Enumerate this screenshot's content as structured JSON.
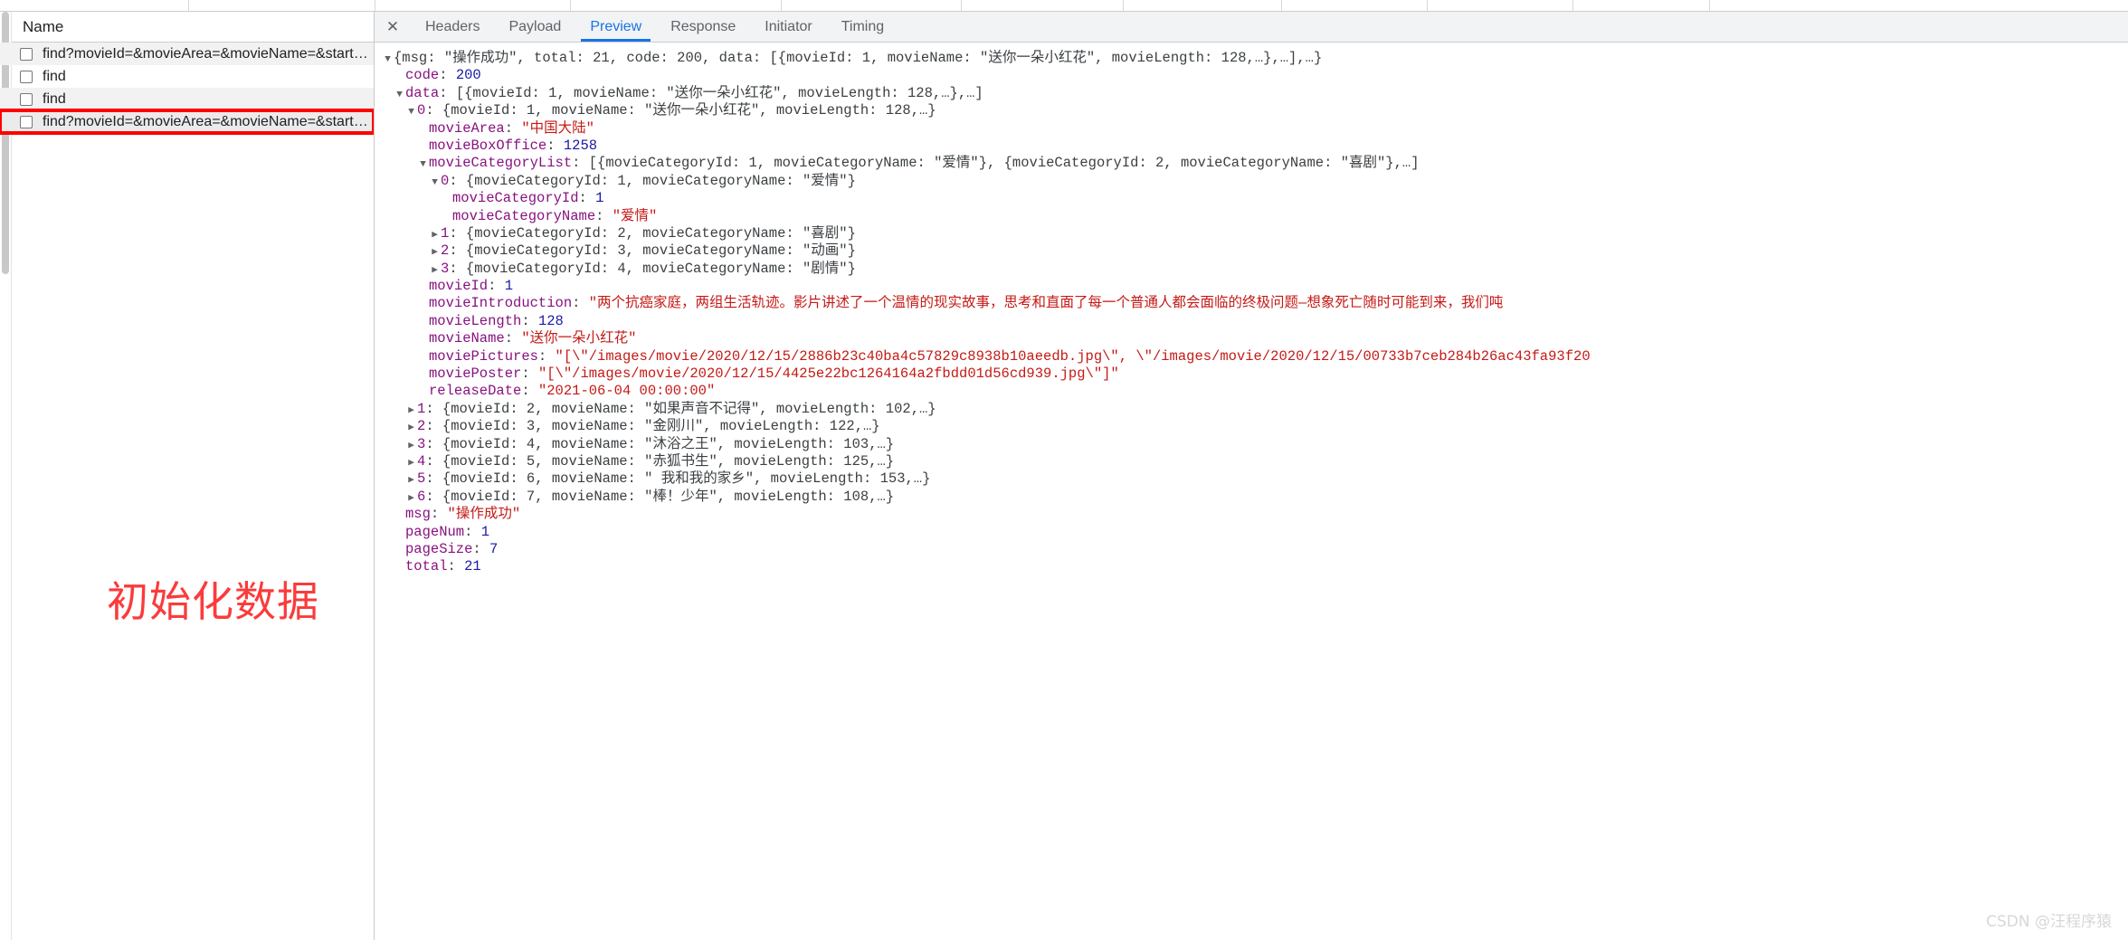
{
  "annotation": {
    "text": "初始化数据"
  },
  "watermark": {
    "text": "CSDN @汪程序猿"
  },
  "request_list": {
    "column_header": "Name",
    "rows": [
      {
        "label": "find?movieId=&movieArea=&movieName=&startDate..."
      },
      {
        "label": "find"
      },
      {
        "label": "find"
      },
      {
        "label": "find?movieId=&movieArea=&movieName=&startDate..."
      }
    ]
  },
  "detail_panel": {
    "close_icon": "close-icon",
    "tabs": [
      {
        "label": "Headers",
        "active": false
      },
      {
        "label": "Payload",
        "active": false
      },
      {
        "label": "Preview",
        "active": true
      },
      {
        "label": "Response",
        "active": false
      },
      {
        "label": "Initiator",
        "active": false
      },
      {
        "label": "Timing",
        "active": false
      }
    ]
  },
  "preview_tree": {
    "rows": [
      {
        "indent": 0,
        "twisty": "▼",
        "segments": [
          {
            "t": "{msg: ",
            "c": "punct"
          },
          {
            "t": "\"操作成功\"",
            "c": "punct"
          },
          {
            "t": ", total: 21, code: 200, data: [{movieId: 1, movieName: ",
            "c": "punct"
          },
          {
            "t": "\"送你一朵小红花\"",
            "c": "punct"
          },
          {
            "t": ", movieLength: 128,…},…],…}",
            "c": "punct"
          }
        ]
      },
      {
        "indent": 1,
        "twisty": "",
        "segments": [
          {
            "t": "code",
            "c": "key"
          },
          {
            "t": ": ",
            "c": "punct"
          },
          {
            "t": "200",
            "c": "num"
          }
        ]
      },
      {
        "indent": 1,
        "twisty": "▼",
        "segments": [
          {
            "t": "data",
            "c": "key"
          },
          {
            "t": ": [{movieId: 1, movieName: ",
            "c": "punct"
          },
          {
            "t": "\"送你一朵小红花\"",
            "c": "punct"
          },
          {
            "t": ", movieLength: 128,…},…]",
            "c": "punct"
          }
        ]
      },
      {
        "indent": 2,
        "twisty": "▼",
        "segments": [
          {
            "t": "0",
            "c": "idx"
          },
          {
            "t": ": {movieId: 1, movieName: ",
            "c": "punct"
          },
          {
            "t": "\"送你一朵小红花\"",
            "c": "punct"
          },
          {
            "t": ", movieLength: 128,…}",
            "c": "punct"
          }
        ]
      },
      {
        "indent": 3,
        "twisty": "",
        "segments": [
          {
            "t": "movieArea",
            "c": "key"
          },
          {
            "t": ": ",
            "c": "punct"
          },
          {
            "t": "\"中国大陆\"",
            "c": "str"
          }
        ]
      },
      {
        "indent": 3,
        "twisty": "",
        "segments": [
          {
            "t": "movieBoxOffice",
            "c": "key"
          },
          {
            "t": ": ",
            "c": "punct"
          },
          {
            "t": "1258",
            "c": "num"
          }
        ]
      },
      {
        "indent": 3,
        "twisty": "▼",
        "segments": [
          {
            "t": "movieCategoryList",
            "c": "key"
          },
          {
            "t": ": [{movieCategoryId: 1, movieCategoryName: ",
            "c": "punct"
          },
          {
            "t": "\"爱情\"",
            "c": "punct"
          },
          {
            "t": "}, {movieCategoryId: 2, movieCategoryName: ",
            "c": "punct"
          },
          {
            "t": "\"喜剧\"",
            "c": "punct"
          },
          {
            "t": "},…]",
            "c": "punct"
          }
        ]
      },
      {
        "indent": 4,
        "twisty": "▼",
        "segments": [
          {
            "t": "0",
            "c": "idx"
          },
          {
            "t": ": {movieCategoryId: 1, movieCategoryName: ",
            "c": "punct"
          },
          {
            "t": "\"爱情\"",
            "c": "punct"
          },
          {
            "t": "}",
            "c": "punct"
          }
        ]
      },
      {
        "indent": 5,
        "twisty": "",
        "segments": [
          {
            "t": "movieCategoryId",
            "c": "key"
          },
          {
            "t": ": ",
            "c": "punct"
          },
          {
            "t": "1",
            "c": "num"
          }
        ]
      },
      {
        "indent": 5,
        "twisty": "",
        "segments": [
          {
            "t": "movieCategoryName",
            "c": "key"
          },
          {
            "t": ": ",
            "c": "punct"
          },
          {
            "t": "\"爱情\"",
            "c": "str"
          }
        ]
      },
      {
        "indent": 4,
        "twisty": "▶",
        "segments": [
          {
            "t": "1",
            "c": "idx"
          },
          {
            "t": ": {movieCategoryId: 2, movieCategoryName: ",
            "c": "punct"
          },
          {
            "t": "\"喜剧\"",
            "c": "punct"
          },
          {
            "t": "}",
            "c": "punct"
          }
        ]
      },
      {
        "indent": 4,
        "twisty": "▶",
        "segments": [
          {
            "t": "2",
            "c": "idx"
          },
          {
            "t": ": {movieCategoryId: 3, movieCategoryName: ",
            "c": "punct"
          },
          {
            "t": "\"动画\"",
            "c": "punct"
          },
          {
            "t": "}",
            "c": "punct"
          }
        ]
      },
      {
        "indent": 4,
        "twisty": "▶",
        "segments": [
          {
            "t": "3",
            "c": "idx"
          },
          {
            "t": ": {movieCategoryId: 4, movieCategoryName: ",
            "c": "punct"
          },
          {
            "t": "\"剧情\"",
            "c": "punct"
          },
          {
            "t": "}",
            "c": "punct"
          }
        ]
      },
      {
        "indent": 3,
        "twisty": "",
        "segments": [
          {
            "t": "movieId",
            "c": "key"
          },
          {
            "t": ": ",
            "c": "punct"
          },
          {
            "t": "1",
            "c": "num"
          }
        ]
      },
      {
        "indent": 3,
        "twisty": "",
        "segments": [
          {
            "t": "movieIntroduction",
            "c": "key"
          },
          {
            "t": ": ",
            "c": "punct"
          },
          {
            "t": "\"两个抗癌家庭，两组生活轨迹。影片讲述了一个温情的现实故事，思考和直面了每一个普通人都会面临的终极问题—想象死亡随时可能到来，我们吨",
            "c": "str"
          }
        ]
      },
      {
        "indent": 3,
        "twisty": "",
        "segments": [
          {
            "t": "movieLength",
            "c": "key"
          },
          {
            "t": ": ",
            "c": "punct"
          },
          {
            "t": "128",
            "c": "num"
          }
        ]
      },
      {
        "indent": 3,
        "twisty": "",
        "segments": [
          {
            "t": "movieName",
            "c": "key"
          },
          {
            "t": ": ",
            "c": "punct"
          },
          {
            "t": "\"送你一朵小红花\"",
            "c": "str"
          }
        ]
      },
      {
        "indent": 3,
        "twisty": "",
        "segments": [
          {
            "t": "moviePictures",
            "c": "key"
          },
          {
            "t": ": ",
            "c": "punct"
          },
          {
            "t": "\"[\\\"/images/movie/2020/12/15/2886b23c40ba4c57829c8938b10aeedb.jpg\\\", \\\"/images/movie/2020/12/15/00733b7ceb284b26ac43fa93f20",
            "c": "str"
          }
        ]
      },
      {
        "indent": 3,
        "twisty": "",
        "segments": [
          {
            "t": "moviePoster",
            "c": "key"
          },
          {
            "t": ": ",
            "c": "punct"
          },
          {
            "t": "\"[\\\"/images/movie/2020/12/15/4425e22bc1264164a2fbdd01d56cd939.jpg\\\"]\"",
            "c": "str"
          }
        ]
      },
      {
        "indent": 3,
        "twisty": "",
        "segments": [
          {
            "t": "releaseDate",
            "c": "key"
          },
          {
            "t": ": ",
            "c": "punct"
          },
          {
            "t": "\"2021-06-04 00:00:00\"",
            "c": "str"
          }
        ]
      },
      {
        "indent": 2,
        "twisty": "▶",
        "segments": [
          {
            "t": "1",
            "c": "idx"
          },
          {
            "t": ": {movieId: 2, movieName: ",
            "c": "punct"
          },
          {
            "t": "\"如果声音不记得\"",
            "c": "punct"
          },
          {
            "t": ", movieLength: 102,…}",
            "c": "punct"
          }
        ]
      },
      {
        "indent": 2,
        "twisty": "▶",
        "segments": [
          {
            "t": "2",
            "c": "idx"
          },
          {
            "t": ": {movieId: 3, movieName: ",
            "c": "punct"
          },
          {
            "t": "\"金刚川\"",
            "c": "punct"
          },
          {
            "t": ", movieLength: 122,…}",
            "c": "punct"
          }
        ]
      },
      {
        "indent": 2,
        "twisty": "▶",
        "segments": [
          {
            "t": "3",
            "c": "idx"
          },
          {
            "t": ": {movieId: 4, movieName: ",
            "c": "punct"
          },
          {
            "t": "\"沐浴之王\"",
            "c": "punct"
          },
          {
            "t": ", movieLength: 103,…}",
            "c": "punct"
          }
        ]
      },
      {
        "indent": 2,
        "twisty": "▶",
        "segments": [
          {
            "t": "4",
            "c": "idx"
          },
          {
            "t": ": {movieId: 5, movieName: ",
            "c": "punct"
          },
          {
            "t": "\"赤狐书生\"",
            "c": "punct"
          },
          {
            "t": ", movieLength: 125,…}",
            "c": "punct"
          }
        ]
      },
      {
        "indent": 2,
        "twisty": "▶",
        "segments": [
          {
            "t": "5",
            "c": "idx"
          },
          {
            "t": ": {movieId: 6, movieName: ",
            "c": "punct"
          },
          {
            "t": "\" 我和我的家乡\"",
            "c": "punct"
          },
          {
            "t": ", movieLength: 153,…}",
            "c": "punct"
          }
        ]
      },
      {
        "indent": 2,
        "twisty": "▶",
        "segments": [
          {
            "t": "6",
            "c": "idx"
          },
          {
            "t": ": {movieId: 7, movieName: ",
            "c": "punct"
          },
          {
            "t": "\"棒！少年\"",
            "c": "punct"
          },
          {
            "t": ", movieLength: 108,…}",
            "c": "punct"
          }
        ]
      },
      {
        "indent": 1,
        "twisty": "",
        "segments": [
          {
            "t": "msg",
            "c": "key"
          },
          {
            "t": ": ",
            "c": "punct"
          },
          {
            "t": "\"操作成功\"",
            "c": "str"
          }
        ]
      },
      {
        "indent": 1,
        "twisty": "",
        "segments": [
          {
            "t": "pageNum",
            "c": "key"
          },
          {
            "t": ": ",
            "c": "punct"
          },
          {
            "t": "1",
            "c": "num"
          }
        ]
      },
      {
        "indent": 1,
        "twisty": "",
        "segments": [
          {
            "t": "pageSize",
            "c": "key"
          },
          {
            "t": ": ",
            "c": "punct"
          },
          {
            "t": "7",
            "c": "num"
          }
        ]
      },
      {
        "indent": 1,
        "twisty": "",
        "segments": [
          {
            "t": "total",
            "c": "key"
          },
          {
            "t": ": ",
            "c": "punct"
          },
          {
            "t": "21",
            "c": "num"
          }
        ]
      }
    ]
  }
}
